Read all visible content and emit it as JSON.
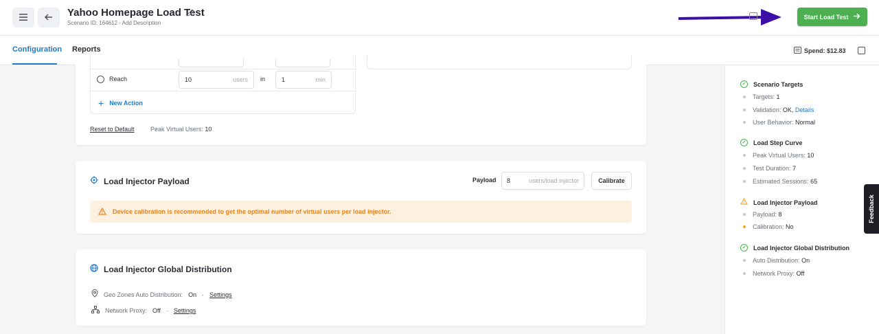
{
  "header": {
    "title": "Yahoo Homepage Load Test",
    "subtitle": "Scenario ID: 164612 - Add Description",
    "start_button": "Start Load Test",
    "start_button_icon": "arrow-right-icon"
  },
  "tabs": [
    {
      "label": "Configuration",
      "active": true
    },
    {
      "label": "Reports",
      "active": false
    }
  ],
  "spend": "Spend: $12.83",
  "load_step": {
    "reach_label": "Reach",
    "users_value": "10",
    "users_unit": "users",
    "in_label": "in",
    "min_value": "1",
    "min_unit": "min",
    "new_action": "New Action",
    "reset": "Reset to Default",
    "peak_label": "Peak Virtual Users:",
    "peak_value": "10"
  },
  "payload_card": {
    "title": "Load Injector Payload",
    "payload_label": "Payload",
    "payload_value": "8",
    "payload_unit": "users/load injector",
    "calibrate": "Calibrate",
    "warning": "Device calibration is recommended to get the optimal number of virtual users per load injector."
  },
  "distribution_card": {
    "title": "Load Injector Global Distribution",
    "geo_label": "Geo Zones Auto Distribution:",
    "geo_value": "On",
    "proxy_label": "Network Proxy:",
    "proxy_value": "Off",
    "sep": "·",
    "settings": "Settings"
  },
  "summary": {
    "scenario_targets": {
      "title": "Scenario Targets",
      "targets_label": "Targets:",
      "targets_value": "1",
      "validation_label": "Validation:",
      "validation_value": "OK,",
      "validation_link": "Details",
      "behavior_label": "User Behavior:",
      "behavior_value": "Normal"
    },
    "load_step_curve": {
      "title": "Load Step Curve",
      "peak_label": "Peak Virtual Users:",
      "peak_value": "10",
      "duration_label": "Test Duration:",
      "duration_value": "7",
      "sessions_label": "Estimated Sessions:",
      "sessions_value": "65"
    },
    "payload": {
      "title": "Load Injector Payload",
      "payload_label": "Payload:",
      "payload_value": "8",
      "calibration_label": "Calibration:",
      "calibration_value": "No"
    },
    "distribution": {
      "title": "Load Injector Global Distribution",
      "auto_label": "Auto Distribution:",
      "auto_value": "On",
      "proxy_label": "Network Proxy:",
      "proxy_value": "Off"
    }
  },
  "feedback": "Feedback",
  "colors": {
    "accent": "#1f7ac9",
    "success": "#4caf50",
    "warning": "#f5a623",
    "annotation_arrow": "#3b0fa8"
  }
}
